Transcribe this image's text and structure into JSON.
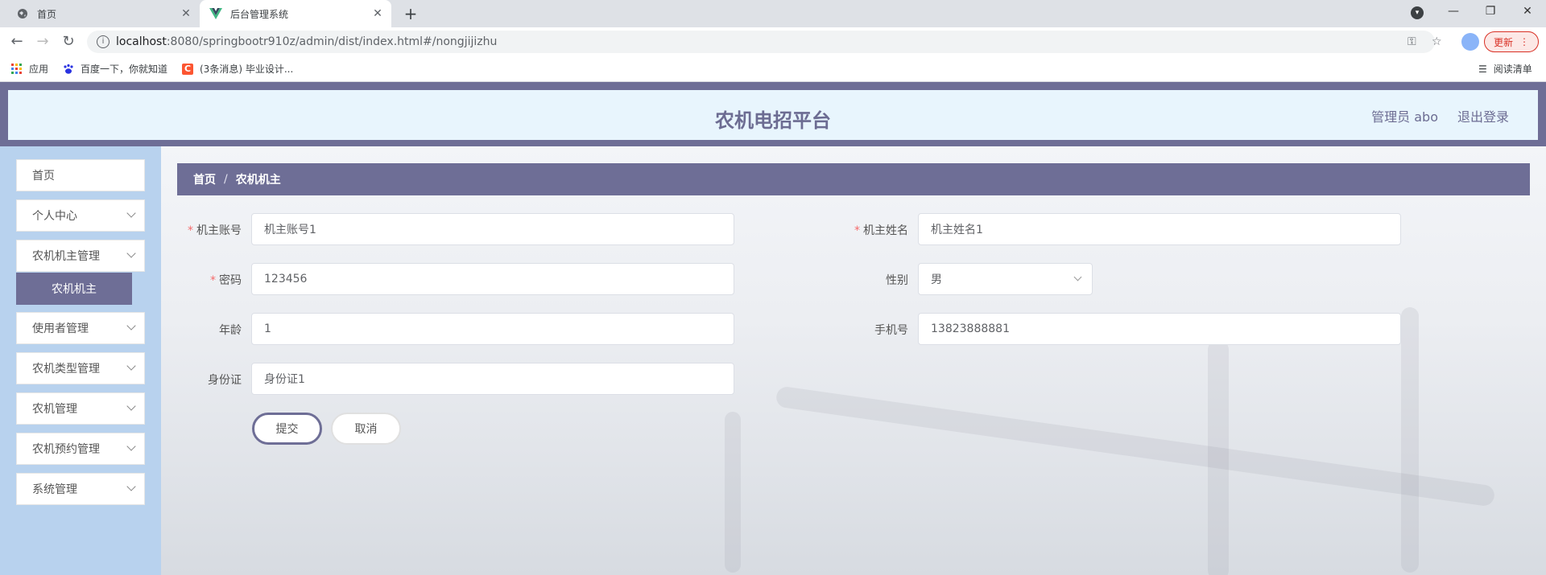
{
  "browser": {
    "tabs": [
      {
        "title": "首页",
        "favicon": "globe-icon"
      },
      {
        "title": "后台管理系统",
        "favicon": "vue-logo-icon"
      }
    ],
    "url_host": "localhost",
    "url_rest": ":8080/springbootr910z/admin/dist/index.html#/nongjijizhu",
    "update_label": "更新",
    "bookmarks": [
      {
        "label": "应用",
        "icon": "apps-grid-icon"
      },
      {
        "label": "百度一下，你就知道",
        "icon": "baidu-paw-icon"
      },
      {
        "label": "(3条消息) 毕业设计...",
        "icon": "csdn-c-icon"
      }
    ],
    "reading_list_label": "阅读清单"
  },
  "header": {
    "title": "农机电招平台",
    "admin_label": "管理员 abo",
    "logout_label": "退出登录"
  },
  "sidebar": {
    "items": [
      {
        "label": "首页",
        "expandable": false
      },
      {
        "label": "个人中心",
        "expandable": true
      },
      {
        "label": "农机机主管理",
        "expandable": true
      },
      {
        "label": "使用者管理",
        "expandable": true
      },
      {
        "label": "农机类型管理",
        "expandable": true
      },
      {
        "label": "农机管理",
        "expandable": true
      },
      {
        "label": "农机预约管理",
        "expandable": true
      },
      {
        "label": "系统管理",
        "expandable": true
      }
    ],
    "active_subitem": "农机机主"
  },
  "breadcrumb": {
    "home": "首页",
    "separator": "/",
    "current": "农机机主"
  },
  "form": {
    "account": {
      "label": "机主账号",
      "value": "机主账号1",
      "required": true
    },
    "name": {
      "label": "机主姓名",
      "value": "机主姓名1",
      "required": true
    },
    "password": {
      "label": "密码",
      "value": "123456",
      "required": true
    },
    "gender": {
      "label": "性别",
      "value": "男",
      "required": false
    },
    "age": {
      "label": "年龄",
      "value": "1",
      "required": false
    },
    "phone": {
      "label": "手机号",
      "value": "13823888881",
      "required": false
    },
    "idcard": {
      "label": "身份证",
      "value": "身份证1",
      "required": false
    },
    "required_mark": "*",
    "submit_label": "提交",
    "cancel_label": "取消"
  },
  "colors": {
    "accent": "#6e6e96",
    "header_bg": "#e8f5fd",
    "sidebar_bg": "#b8d2ee",
    "required": "#f56c6c"
  }
}
